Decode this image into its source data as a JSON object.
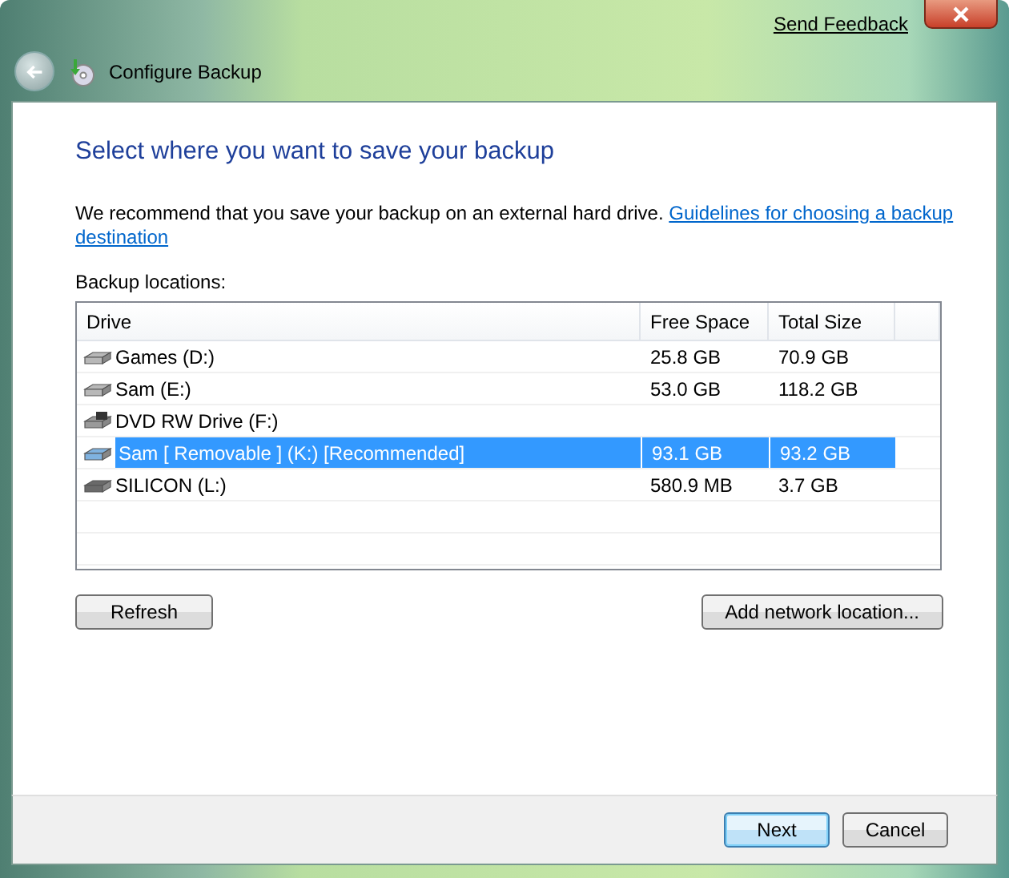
{
  "window": {
    "title": "Configure Backup",
    "send_feedback": "Send Feedback"
  },
  "heading": "Select where you want to save your backup",
  "intro": {
    "text": "We recommend that you save your backup on an external hard drive. ",
    "link_lines": [
      "Guidelines for choosing a backup",
      "destination"
    ]
  },
  "locations_label": "Backup locations:",
  "table": {
    "columns": [
      "Drive",
      "Free Space",
      "Total Size"
    ],
    "rows": [
      {
        "kind": "hdd",
        "drive": "Games (D:)",
        "free_space": "25.8 GB",
        "total_size": "70.9 GB",
        "selected": false
      },
      {
        "kind": "hdd",
        "drive": "Sam (E:)",
        "free_space": "53.0 GB",
        "total_size": "118.2 GB",
        "selected": false
      },
      {
        "kind": "dvd",
        "drive": "DVD RW Drive (F:)",
        "free_space": "",
        "total_size": "",
        "selected": false
      },
      {
        "kind": "removable",
        "drive": "Sam [ Removable ] (K:) [Recommended]",
        "free_space": "93.1 GB",
        "total_size": "93.2 GB",
        "selected": true
      },
      {
        "kind": "usb",
        "drive": "SILICON (L:)",
        "free_space": "580.9 MB",
        "total_size": "3.7 GB",
        "selected": false
      }
    ]
  },
  "buttons": {
    "refresh": "Refresh",
    "add_network": "Add network location...",
    "next": "Next",
    "cancel": "Cancel"
  }
}
